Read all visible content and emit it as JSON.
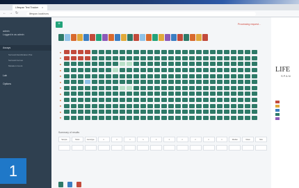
{
  "window": {
    "tab_title": "Lifespan Test Tracker",
    "url": "lifespan.local/runs"
  },
  "sidebar": {
    "user_name": "admin",
    "user_role": "Logged in as admin",
    "items": [
      {
        "label": "Assays"
      },
      {
        "label": "Lab"
      },
      {
        "label": "Options"
      }
    ],
    "subitems": [
      "Survival Identification Plot",
      "Survival Curves",
      "Mutation Count"
    ]
  },
  "badge_number": "1",
  "main": {
    "add_button": "+",
    "alert_text": "Processing request…",
    "summary_title": "Summary of results",
    "summary_headers": [
      "Sample",
      "Strain",
      "Genotype",
      "n",
      "n",
      "n",
      "n",
      "n",
      "n",
      "n",
      "n",
      "n",
      "n",
      "Median",
      "Mean",
      "Max"
    ],
    "summary_values": [
      "",
      "",
      "",
      "",
      "",
      "",
      "",
      "",
      "",
      "",
      "",
      "",
      "",
      "",
      "",
      ""
    ]
  },
  "right_panel": {
    "brand": "LIFE",
    "brand_sub": "SPAN"
  },
  "colors": {
    "accent_green": "#22a37a",
    "cell_dark": "#2e7a68",
    "cell_light": "#b8dfc7",
    "cell_blue": "#8fc2e8",
    "label_orange": "#d86a2e",
    "badge_blue": "#1f78c8"
  },
  "grid_rows": [
    [
      "r",
      "r",
      "r",
      "r",
      "d",
      "d",
      "d",
      "d",
      "d",
      "d",
      "d",
      "d",
      "d",
      "d",
      "d",
      "d",
      "d",
      "d",
      "d",
      "d",
      "d",
      "d",
      "d",
      "d",
      "d",
      "d",
      "d",
      "d"
    ],
    [
      "r",
      "r",
      "r",
      "r",
      "d",
      "d",
      "d",
      "d",
      "d",
      "d",
      "d",
      "d",
      "d",
      "d",
      "d",
      "d",
      "d",
      "d",
      "d",
      "d",
      "d",
      "d",
      "d",
      "d",
      "d",
      "d",
      "d",
      "d"
    ],
    [
      "d",
      "d",
      "d",
      "d",
      "d",
      "d",
      "d",
      "d",
      "l",
      "l",
      "d",
      "d",
      "d",
      "d",
      "d",
      "d",
      "d",
      "d",
      "d",
      "d",
      "d",
      "d",
      "d",
      "d",
      "d",
      "d",
      "d",
      "d"
    ],
    [
      "d",
      "d",
      "d",
      "d",
      "d",
      "d",
      "d",
      "l",
      "d",
      "d",
      "d",
      "d",
      "d",
      "d",
      "d",
      "d",
      "d",
      "d",
      "d",
      "d",
      "d",
      "d",
      "d",
      "d",
      "d",
      "d",
      "d",
      "d"
    ],
    [
      "d",
      "d",
      "d",
      "d",
      "d",
      "d",
      "d",
      "d",
      "d",
      "d",
      "d",
      "d",
      "d",
      "d",
      "d",
      "d",
      "d",
      "d",
      "d",
      "d",
      "d",
      "d",
      "d",
      "d",
      "d",
      "d",
      "d",
      "d"
    ],
    [
      "d",
      "d",
      "d",
      "b",
      "d",
      "d",
      "d",
      "d",
      "d",
      "d",
      "d",
      "d",
      "d",
      "d",
      "d",
      "d",
      "d",
      "d",
      "d",
      "d",
      "d",
      "d",
      "d",
      "d",
      "d",
      "d",
      "d",
      "d"
    ],
    [
      "d",
      "d",
      "d",
      "d",
      "d",
      "d",
      "d",
      "d",
      "l",
      "l",
      "d",
      "d",
      "d",
      "d",
      "d",
      "d",
      "d",
      "d",
      "d",
      "d",
      "d",
      "d",
      "d",
      "d",
      "d",
      "d",
      "d",
      "d"
    ],
    [
      "d",
      "d",
      "d",
      "d",
      "d",
      "d",
      "d",
      "d",
      "d",
      "d",
      "d",
      "d",
      "d",
      "d",
      "d",
      "d",
      "d",
      "d",
      "d",
      "d",
      "d",
      "d",
      "d",
      "d",
      "d",
      "d",
      "d",
      "d"
    ],
    [
      "d",
      "d",
      "d",
      "d",
      "d",
      "d",
      "d",
      "d",
      "d",
      "d",
      "d",
      "d",
      "d",
      "d",
      "d",
      "d",
      "d",
      "d",
      "d",
      "d",
      "d",
      "d",
      "d",
      "d",
      "d",
      "d",
      "d",
      "d"
    ],
    [
      "d",
      "d",
      "d",
      "d",
      "d",
      "d",
      "d",
      "d",
      "d",
      "d",
      "d",
      "d",
      "d",
      "d",
      "d",
      "d",
      "d",
      "d",
      "d",
      "d",
      "d",
      "d",
      "d",
      "d",
      "d",
      "d",
      "d",
      "d"
    ],
    [
      "d",
      "d",
      "d",
      "d",
      "d",
      "d",
      "d",
      "d",
      "d",
      "d",
      "d",
      "d",
      "d",
      "d",
      "d",
      "d",
      "d",
      "d",
      "d",
      "d",
      "d",
      "d",
      "d",
      "d",
      "d",
      "d",
      "d",
      "d"
    ],
    [
      "d",
      "d",
      "d",
      "d",
      "d",
      "d",
      "d",
      "d",
      "d",
      "d",
      "d",
      "d",
      "d",
      "d",
      "d",
      "d",
      "d",
      "d",
      "d",
      "d",
      "d",
      "d",
      "d",
      "d",
      "d",
      "d",
      "d",
      "d"
    ]
  ]
}
